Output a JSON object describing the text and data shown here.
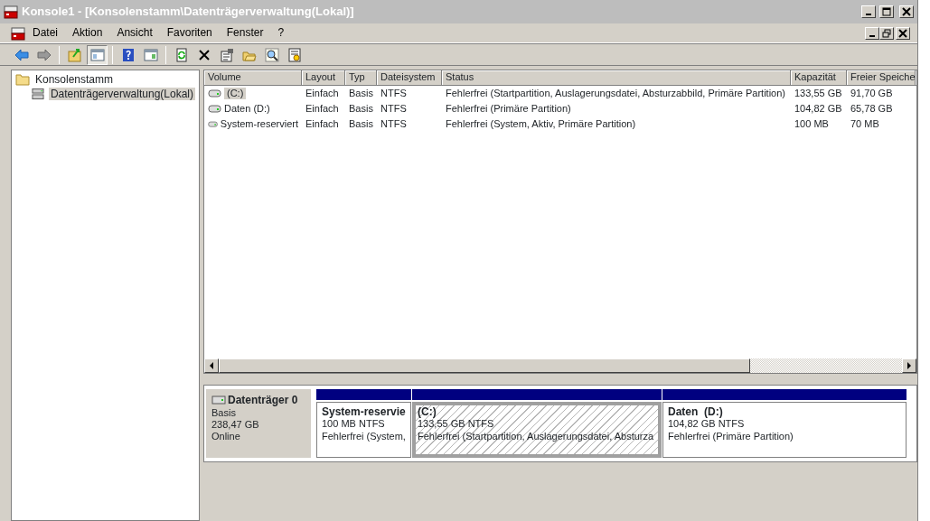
{
  "window": {
    "title": "Konsole1 - [Konsolenstamm\\Datenträgerverwaltung(Lokal)]"
  },
  "menu": [
    "Datei",
    "Aktion",
    "Ansicht",
    "Favoriten",
    "Fenster",
    "?"
  ],
  "toolbar_groups": [
    [
      {
        "pressed": false
      },
      {
        "pressed": false
      }
    ],
    [
      {
        "pressed": false
      },
      {
        "pressed": true
      }
    ],
    [
      {
        "pressed": false
      },
      {
        "pressed": false
      }
    ],
    [
      {
        "pressed": false
      },
      {
        "pressed": false
      },
      {
        "pressed": false
      },
      {
        "pressed": false
      },
      {
        "pressed": false
      },
      {
        "pressed": false
      }
    ]
  ],
  "tree": [
    {
      "label": "Konsolenstamm",
      "selected": false,
      "children": [
        {
          "label": "Datenträgerverwaltung(Lokal)",
          "selected": true
        }
      ]
    }
  ],
  "table": {
    "columns": [
      "Volume",
      "Layout",
      "Typ",
      "Dateisystem",
      "Status",
      "Kapazität",
      "Freier Speiche"
    ],
    "rows": [
      {
        "selected": true,
        "cells": [
          "(C:)",
          "Einfach",
          "Basis",
          "NTFS",
          "Fehlerfrei (Startpartition, Auslagerungsdatei, Absturzabbild, Primäre Partition)",
          "133,55 GB",
          "91,70 GB"
        ]
      },
      {
        "selected": false,
        "cells": [
          "Daten (D:)",
          "Einfach",
          "Basis",
          "NTFS",
          "Fehlerfrei (Primäre Partition)",
          "104,82 GB",
          "65,78 GB"
        ]
      },
      {
        "selected": false,
        "cells": [
          "System-reserviert",
          "Einfach",
          "Basis",
          "NTFS",
          "Fehlerfrei (System, Aktiv, Primäre Partition)",
          "100 MB",
          "70 MB"
        ]
      }
    ]
  },
  "disk": {
    "name": "Datenträger 0",
    "type": "Basis",
    "size": "238,47 GB",
    "status": "Online",
    "partitions": [
      {
        "name": "System-reservie",
        "size": "100 MB NTFS",
        "status": "Fehlerfrei (System,",
        "selected": false
      },
      {
        "name": "(C:)",
        "size": "133,55 GB NTFS",
        "status": "Fehlerfrei (Startpartition, Auslagerungsdatei, Absturza",
        "selected": true
      },
      {
        "name": "Daten  (D:)",
        "size": "104,82 GB NTFS",
        "status": "Fehlerfrei (Primäre Partition)",
        "selected": false
      }
    ]
  }
}
